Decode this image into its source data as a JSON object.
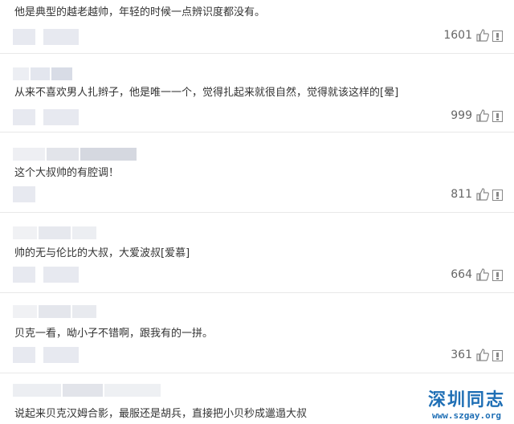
{
  "comments": [
    {
      "text": "他是典型的越老越帅，年轻的时候一点辨识度都没有。",
      "likes": "1601"
    },
    {
      "text": "从来不喜欢男人扎辫子，他是唯一一个，觉得扎起来就很自然，觉得就该这样的[晕]",
      "likes": "999"
    },
    {
      "text": "这个大叔帅的有腔调！",
      "likes": "811"
    },
    {
      "text": "帅的无与伦比的大叔，大爱波叔[爱慕]",
      "likes": "664"
    },
    {
      "text": "贝克一看，呦小子不错啊，跟我有的一拼。",
      "likes": "361"
    },
    {
      "text": "说起来贝克汉姆合影，最服还是胡兵，直接把小贝秒成邋遢大叔",
      "likes": ""
    }
  ],
  "watermark": {
    "title": "深圳同志",
    "url": "www.szgay.org"
  },
  "colors": {
    "accent": "#1f6fb5",
    "blur": "#e7e9f0"
  }
}
